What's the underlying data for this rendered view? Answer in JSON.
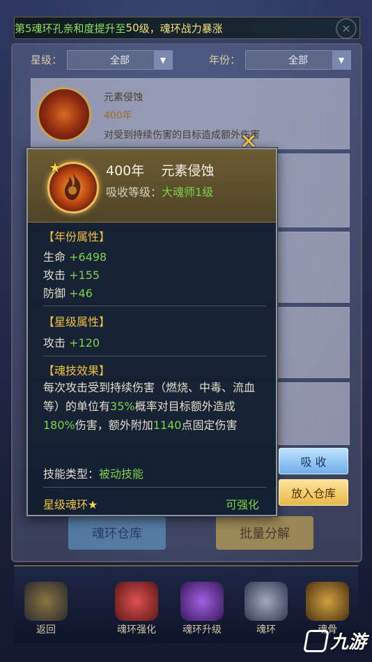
{
  "marquee": {
    "part1": "第5魂环孔亲和度提升至",
    "level": "50",
    "part2": "级，魂环战力暴涨"
  },
  "filters": {
    "star_label": "星级：",
    "star_value": "全部",
    "year_label": "年份：",
    "year_value": "全部"
  },
  "list": [
    {
      "name": "元素侵蚀",
      "year": "400年",
      "desc": "对受到持续伤害的目标造成额外伤害"
    }
  ],
  "bottom_buttons": {
    "warehouse": "魂环仓库",
    "split": "批量分解"
  },
  "nav": [
    {
      "label": "返回"
    },
    {
      "label": "魂环强化"
    },
    {
      "label": "魂环升级"
    },
    {
      "label": "魂环"
    },
    {
      "label": "魂骨"
    }
  ],
  "popup": {
    "title": "400年    元素侵蚀",
    "absorb_label": "吸收等级：",
    "absorb_value": "大魂师1级",
    "sec_year": "【年份属性】",
    "hp_label": "生命",
    "hp_value": "+6498",
    "atk_label": "攻击",
    "atk_value": "+155",
    "def_label": "防御",
    "def_value": "+46",
    "sec_star": "【星级属性】",
    "star_atk_label": "攻击",
    "star_atk_value": "+120",
    "sec_skill": "【魂技效果】",
    "desc_1": "每次攻击受到持续伤害（燃烧、中毒、流血等）的单位有",
    "desc_pct": "35%",
    "desc_2": "概率对目标额外造成",
    "desc_dmg": "180%",
    "desc_3": "伤害，额外附加",
    "desc_pts": "1140",
    "desc_4": "点固定伤害",
    "skill_type_label": "技能类型：",
    "skill_type_value": "被动技能",
    "footer_left": "星级魂环",
    "footer_right": "可强化"
  },
  "side_buttons": {
    "absorb": "吸 收",
    "store": "放入仓库"
  },
  "watermark": "九游",
  "colors": {
    "green": "#7ed14a",
    "gold": "#f0c040"
  },
  "icons": [
    "close-icon",
    "star-icon",
    "flame-icon",
    "chevron-down-icon"
  ]
}
